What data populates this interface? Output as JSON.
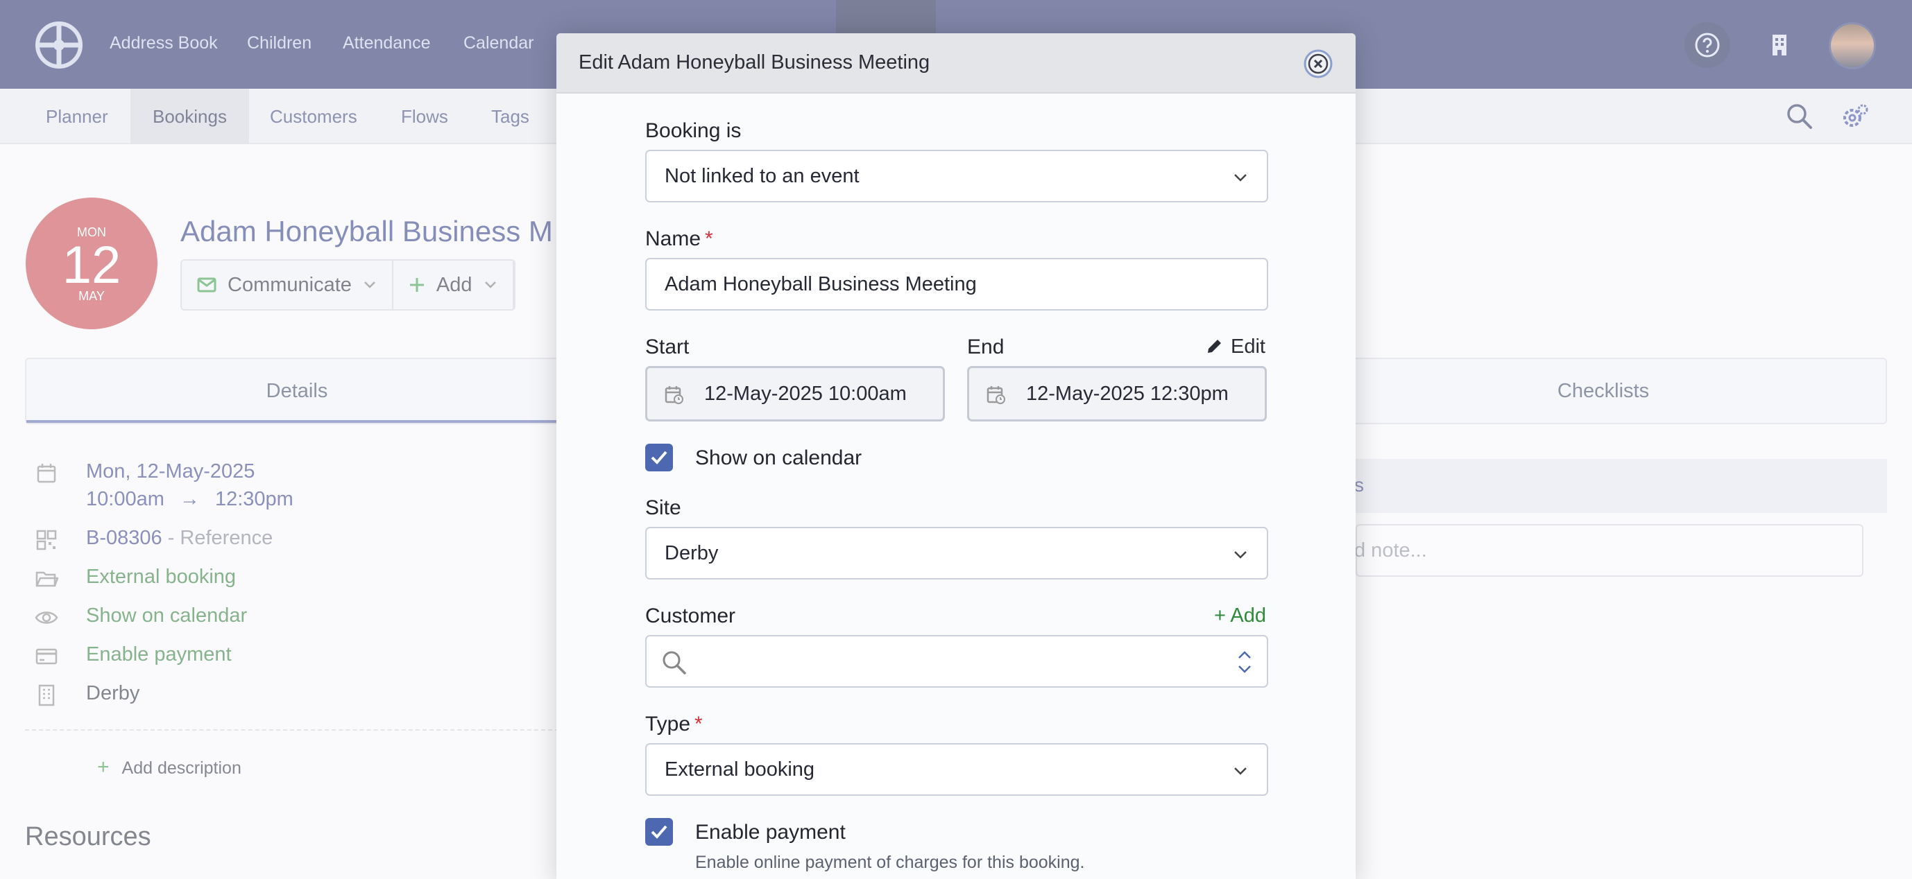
{
  "topnav": {
    "items": [
      "Address Book",
      "Children",
      "Attendance",
      "Calendar"
    ],
    "icons": [
      "app-logo-icon",
      "help-icon",
      "building-icon",
      "user-avatar"
    ]
  },
  "subnav": {
    "items": [
      "Planner",
      "Bookings",
      "Customers",
      "Flows",
      "Tags"
    ],
    "active": "Bookings",
    "icons": [
      "search-icon",
      "settings-cog-icon"
    ]
  },
  "booking": {
    "date_badge": {
      "dow": "MON",
      "day": "12",
      "month": "MAY"
    },
    "title": "Adam Honeyball Business M",
    "actions": {
      "communicate": "Communicate",
      "add": "Add"
    },
    "tabs": {
      "details": "Details",
      "checklists": "Checklists"
    },
    "details": {
      "date": "Mon, 12-May-2025",
      "time_start": "10:00am",
      "arrow": "→",
      "time_end": "12:30pm",
      "reference_id": "B-08306",
      "reference_suffix": " - Reference",
      "type": "External booking",
      "calendar": "Show on calendar",
      "payment": "Enable payment",
      "site": "Derby"
    },
    "add_description": "Add description",
    "resources_heading": "Resources",
    "notes_heading_fragment": "s",
    "notes_placeholder_fragment": "d note..."
  },
  "modal": {
    "title": "Edit Adam Honeyball Business Meeting",
    "booking_is": {
      "label": "Booking is",
      "value": "Not linked to an event"
    },
    "name": {
      "label": "Name",
      "required_mark": "*",
      "value": "Adam Honeyball Business Meeting"
    },
    "start": {
      "label": "Start",
      "value": "12-May-2025 10:00am"
    },
    "end": {
      "label": "End",
      "value": "12-May-2025 12:30pm",
      "edit_label": "Edit"
    },
    "show_on_calendar": {
      "label": "Show on calendar",
      "checked": true
    },
    "site": {
      "label": "Site",
      "value": "Derby"
    },
    "customer": {
      "label": "Customer",
      "add_label": "+ Add",
      "value": ""
    },
    "type": {
      "label": "Type",
      "required_mark": "*",
      "value": "External booking"
    },
    "enable_payment": {
      "label": "Enable payment",
      "checked": true,
      "help": "Enable online payment of charges for this booking."
    }
  },
  "colors": {
    "nav": "#28306b",
    "accent": "#4d68b0",
    "green": "#2f8a3c",
    "badge": "#c7484f"
  }
}
